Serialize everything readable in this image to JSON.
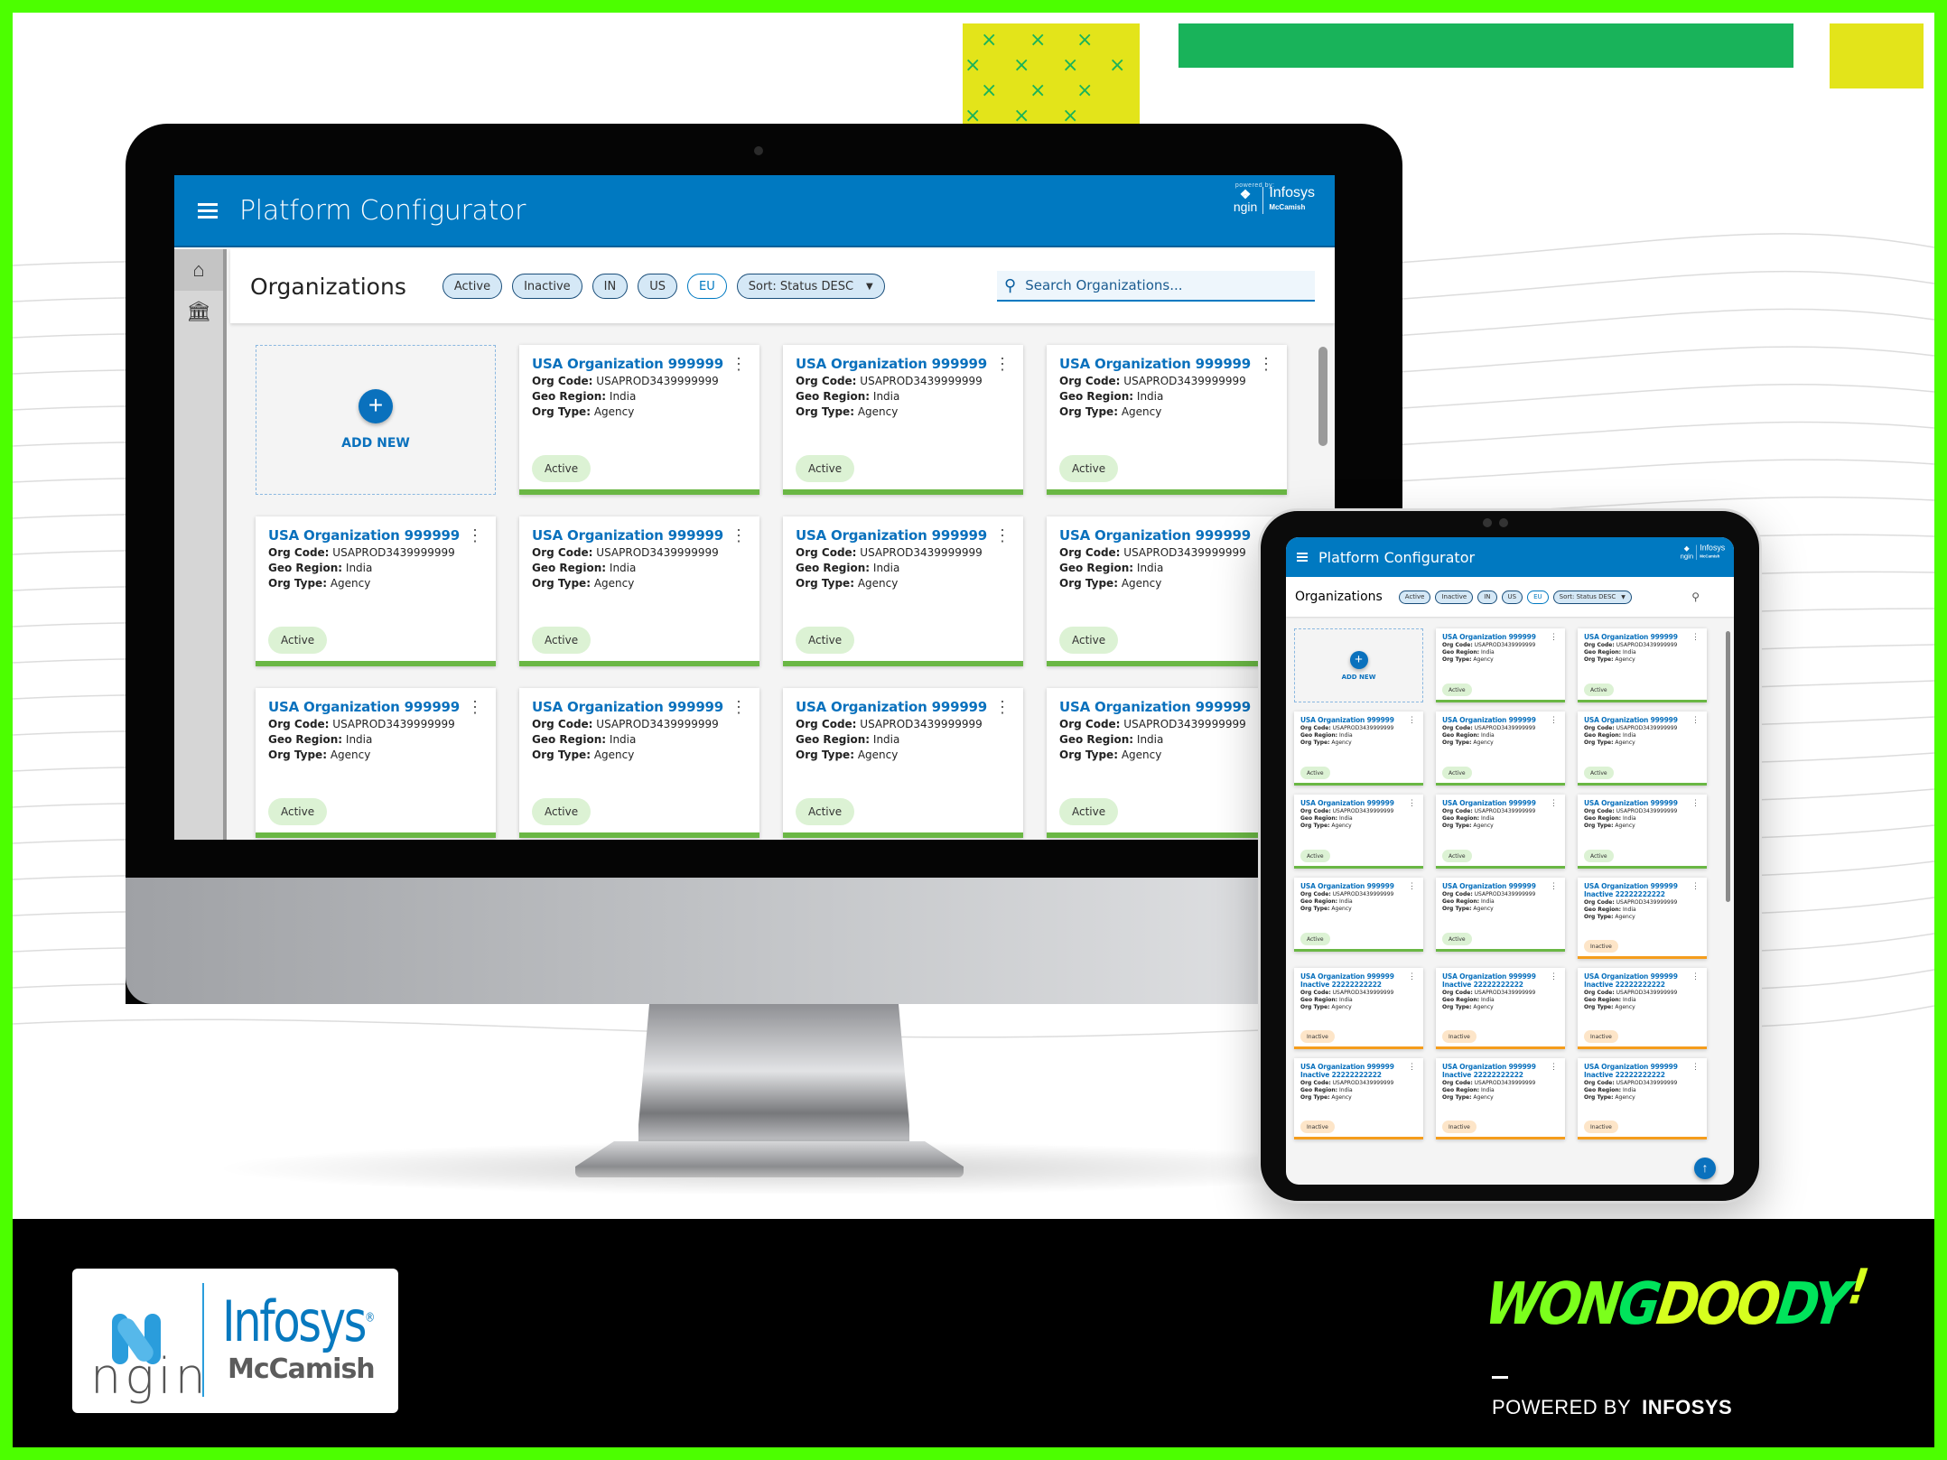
{
  "app": {
    "title": "Platform Configurator",
    "brand": {
      "powered_by": "powered by:",
      "ngin": "ngin",
      "infosys": "Infosys",
      "mccamish": "McCamish"
    }
  },
  "sidebar": {
    "items": [
      {
        "icon": "home-icon"
      },
      {
        "icon": "bank-icon"
      }
    ]
  },
  "page": {
    "title": "Organizations",
    "filters": [
      {
        "label": "Active",
        "selected": true
      },
      {
        "label": "Inactive",
        "selected": true
      },
      {
        "label": "IN",
        "selected": true
      },
      {
        "label": "US",
        "selected": true
      },
      {
        "label": "EU",
        "selected": false
      }
    ],
    "sort": {
      "label": "Sort: Status DESC",
      "caret": "▼"
    },
    "search": {
      "placeholder": "Search Organizations..."
    },
    "add_new": {
      "plus": "+",
      "label": "ADD NEW"
    }
  },
  "labels": {
    "org_code": "Org Code:",
    "geo_region": "Geo Region:",
    "org_type": "Org Type:"
  },
  "desktop_cards": [
    {
      "name": "USA Organization 999999",
      "org_code": "USAPROD3439999999",
      "geo_region": "India",
      "org_type": "Agency",
      "status": "Active"
    },
    {
      "name": "USA Organization 999999",
      "org_code": "USAPROD3439999999",
      "geo_region": "India",
      "org_type": "Agency",
      "status": "Active"
    },
    {
      "name": "USA Organization 999999",
      "org_code": "USAPROD3439999999",
      "geo_region": "India",
      "org_type": "Agency",
      "status": "Active"
    },
    {
      "name": "USA Organization 999999",
      "org_code": "USAPROD3439999999",
      "geo_region": "India",
      "org_type": "Agency",
      "status": "Active"
    },
    {
      "name": "USA Organization 999999",
      "org_code": "USAPROD3439999999",
      "geo_region": "India",
      "org_type": "Agency",
      "status": "Active"
    },
    {
      "name": "USA Organization 999999",
      "org_code": "USAPROD3439999999",
      "geo_region": "India",
      "org_type": "Agency",
      "status": "Active"
    },
    {
      "name": "USA Organization 999999",
      "org_code": "USAPROD3439999999",
      "geo_region": "India",
      "org_type": "Agency",
      "status": "Active"
    },
    {
      "name": "USA Organization 999999",
      "org_code": "USAPROD3439999999",
      "geo_region": "India",
      "org_type": "Agency",
      "status": "Active"
    },
    {
      "name": "USA Organization 999999",
      "org_code": "USAPROD3439999999",
      "geo_region": "India",
      "org_type": "Agency",
      "status": "Active"
    },
    {
      "name": "USA Organization 999999",
      "org_code": "USAPROD3439999999",
      "geo_region": "India",
      "org_type": "Agency",
      "status": "Active"
    },
    {
      "name": "USA Organization 999999",
      "org_code": "USAPROD3439999999",
      "geo_region": "India",
      "org_type": "Agency",
      "status": "Active"
    }
  ],
  "tablet_cards": [
    {
      "name": "USA Organization 999999",
      "org_code": "USAPROD3439999999",
      "geo_region": "India",
      "org_type": "Agency",
      "status": "Active"
    },
    {
      "name": "USA Organization 999999",
      "org_code": "USAPROD3439999999",
      "geo_region": "India",
      "org_type": "Agency",
      "status": "Active"
    },
    {
      "name": "USA Organization 999999",
      "org_code": "USAPROD3439999999",
      "geo_region": "India",
      "org_type": "Agency",
      "status": "Active"
    },
    {
      "name": "USA Organization 999999",
      "org_code": "USAPROD3439999999",
      "geo_region": "India",
      "org_type": "Agency",
      "status": "Active"
    },
    {
      "name": "USA Organization 999999",
      "org_code": "USAPROD3439999999",
      "geo_region": "India",
      "org_type": "Agency",
      "status": "Active"
    },
    {
      "name": "USA Organization 999999",
      "org_code": "USAPROD3439999999",
      "geo_region": "India",
      "org_type": "Agency",
      "status": "Active"
    },
    {
      "name": "USA Organization 999999",
      "org_code": "USAPROD3439999999",
      "geo_region": "India",
      "org_type": "Agency",
      "status": "Active"
    },
    {
      "name": "USA Organization 999999",
      "org_code": "USAPROD3439999999",
      "geo_region": "India",
      "org_type": "Agency",
      "status": "Active"
    },
    {
      "name": "USA Organization 999999",
      "org_code": "USAPROD3439999999",
      "geo_region": "India",
      "org_type": "Agency",
      "status": "Active"
    },
    {
      "name": "USA Organization 999999",
      "org_code": "USAPROD3439999999",
      "geo_region": "India",
      "org_type": "Agency",
      "status": "Active"
    },
    {
      "name": "USA Organization 999999 Inactive 22222222222",
      "org_code": "USAPROD3439999999",
      "geo_region": "India",
      "org_type": "Agency",
      "status": "Inactive"
    },
    {
      "name": "USA Organization 999999 Inactive 22222222222",
      "org_code": "USAPROD3439999999",
      "geo_region": "India",
      "org_type": "Agency",
      "status": "Inactive"
    },
    {
      "name": "USA Organization 999999 Inactive 22222222222",
      "org_code": "USAPROD3439999999",
      "geo_region": "India",
      "org_type": "Agency",
      "status": "Inactive"
    },
    {
      "name": "USA Organization 999999 Inactive 22222222222",
      "org_code": "USAPROD3439999999",
      "geo_region": "India",
      "org_type": "Agency",
      "status": "Inactive"
    },
    {
      "name": "USA Organization 999999 Inactive 22222222222",
      "org_code": "USAPROD3439999999",
      "geo_region": "India",
      "org_type": "Agency",
      "status": "Inactive"
    },
    {
      "name": "USA Organization 999999 Inactive 22222222222",
      "org_code": "USAPROD3439999999",
      "geo_region": "India",
      "org_type": "Agency",
      "status": "Inactive"
    },
    {
      "name": "USA Organization 999999 Inactive 22222222222",
      "org_code": "USAPROD3439999999",
      "geo_region": "India",
      "org_type": "Agency",
      "status": "Inactive"
    }
  ],
  "tablet_fab": {
    "icon": "arrow-up-icon",
    "glyph": "↑"
  },
  "footer": {
    "logo": {
      "ngin": "ngin",
      "infosys": "Infosys",
      "registered": "®",
      "mccamish": "McCamish"
    },
    "agency": {
      "part1": "WON",
      "part2": "G",
      "part3": "DOO",
      "part4": "DY",
      "mark": "!"
    },
    "powered_by": "POWERED BY",
    "powered_by_brand": "INFOSYS"
  },
  "colors": {
    "primary": "#0079c1",
    "active": "#6ab744",
    "inactive": "#f59d1c",
    "border": "#4cff00",
    "accent_green": "#19b35a",
    "accent_yellow": "#e3e41a"
  }
}
